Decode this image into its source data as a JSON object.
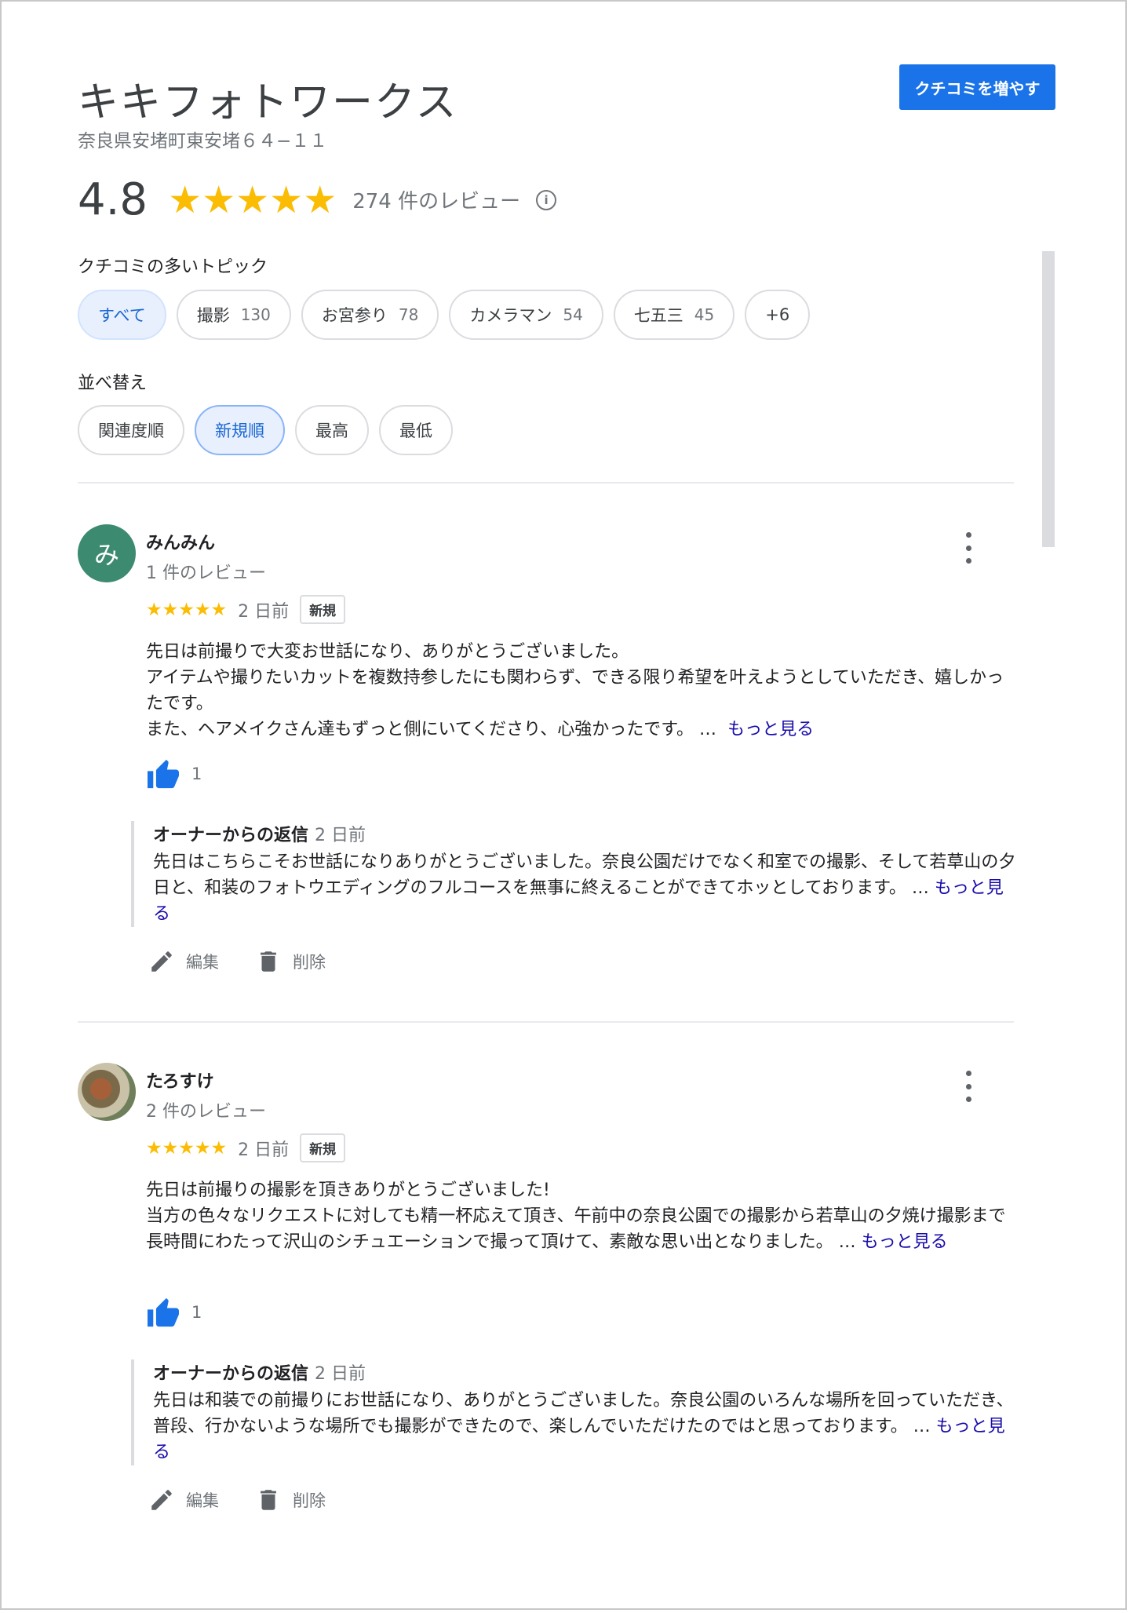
{
  "business": {
    "name": "キキフォトワークス",
    "address": "奈良県安堵町東安堵６４−１１",
    "add_reviews_button": "クチコミを増やす"
  },
  "summary": {
    "rating": "4.8",
    "stars": "★★★★★",
    "review_count": "274 件のレビュー",
    "info_icon": "i"
  },
  "topics": {
    "label": "クチコミの多いトピック",
    "chips": [
      {
        "label": "すべて",
        "count": ""
      },
      {
        "label": "撮影",
        "count": "130"
      },
      {
        "label": "お宮参り",
        "count": "78"
      },
      {
        "label": "カメラマン",
        "count": "54"
      },
      {
        "label": "七五三",
        "count": "45"
      },
      {
        "label": "+6",
        "count": ""
      }
    ]
  },
  "sort": {
    "label": "並べ替え",
    "options": [
      "関連度順",
      "新規順",
      "最高",
      "最低"
    ],
    "selected": "新規順"
  },
  "reviews": [
    {
      "avatar_letter": "み",
      "name": "みんみん",
      "sub": "1 件のレビュー",
      "stars": "★★★★★",
      "date": "2 日前",
      "badge": "新規",
      "text_lines": [
        "先日は前撮りで大変お世話になり、ありがとうございました。",
        "アイテムや撮りたいカットを複数持参したにも関わらず、できる限り希望を叶えようとしていただき、嬉しかったです。",
        "また、ヘアメイクさん達もずっと側にいてくださり、心強かったです。"
      ],
      "ellipsis": " …",
      "more": "もっと見る",
      "likes": "1",
      "owner_title": "オーナーからの返信",
      "owner_date": "2 日前",
      "owner_text": "先日はこちらこそお世話になりありがとうございました。奈良公園だけでなく和室での撮影、そして若草山の夕日と、和装のフォトウエディングのフルコースを無事に終えることができてホッとしております。",
      "owner_more": "もっと見る",
      "edit": "編集",
      "delete": "削除"
    },
    {
      "avatar_letter": "",
      "name": "たろすけ",
      "sub": "2 件のレビュー",
      "stars": "★★★★★",
      "date": "2 日前",
      "badge": "新規",
      "text_lines": [
        "先日は前撮りの撮影を頂きありがとうございました!",
        "当方の色々なリクエストに対しても精一杯応えて頂き、午前中の奈良公園での撮影から若草山の夕焼け撮影まで長時間にわたって沢山のシチュエーションで撮って頂けて、素敵な思い出となりました。"
      ],
      "ellipsis": " …",
      "more": "もっと見る",
      "likes": "1",
      "owner_title": "オーナーからの返信",
      "owner_date": "2 日前",
      "owner_text": "先日は和装での前撮りにお世話になり、ありがとうございました。奈良公園のいろんな場所を回っていただき、普段、行かないような場所でも撮影ができたので、楽しんでいただけたのではと思っております。",
      "owner_more": "もっと見る",
      "edit": "編集",
      "delete": "削除"
    }
  ],
  "colors": {
    "accent": "#1a73e8",
    "star": "#fbbc04",
    "link": "#1a0dab",
    "avatar_green": "#3c8a6f"
  }
}
